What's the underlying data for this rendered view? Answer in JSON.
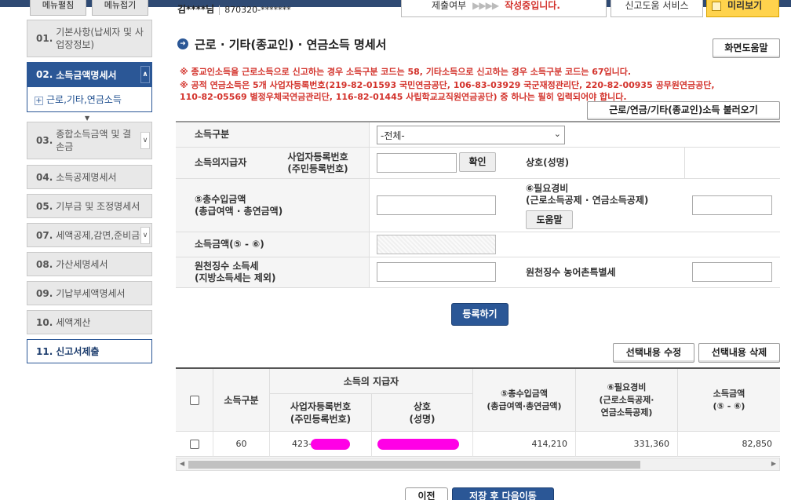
{
  "header": {
    "left_buttons": [
      "메뉴펼침",
      "메뉴접기"
    ],
    "taxpayer_name": "김****님",
    "taxpayer_rrn": "870320-*******",
    "status_label": "제출여부",
    "status_arrows": "▶▶▶▶",
    "status_value": "작성중입니다.",
    "help_service": "신고도움 서비스",
    "preview": "미리보기"
  },
  "sidebar": {
    "items": [
      {
        "num": "01.",
        "label": "기본사항(납세자 및 사업장정보)"
      },
      {
        "num": "02.",
        "label": "소득금액명세서"
      },
      {
        "num": "03.",
        "label": "종합소득금액 및 결손금"
      },
      {
        "num": "04.",
        "label": "소득공제명세서"
      },
      {
        "num": "05.",
        "label": "기부금 및 조정명세서"
      },
      {
        "num": "07.",
        "label": "세액공제,감면,준비금"
      },
      {
        "num": "08.",
        "label": "가산세명세서"
      },
      {
        "num": "09.",
        "label": "기납부세액명세서"
      },
      {
        "num": "10.",
        "label": "세액계산"
      },
      {
        "num": "11.",
        "label": "신고서제출"
      }
    ],
    "sub_item": "근로,기타,연금소득",
    "chev_up": "∧",
    "chev_down": "∨",
    "expand_arrow": "▼"
  },
  "main": {
    "section_icon": "➜",
    "title": "근로 · 기타(종교인) · 연금소득 명세서",
    "screen_help": "화면도움말",
    "notices": [
      "※ 종교인소득을 근로소득으로 신고하는 경우 소득구분 코드는 58, 기타소득으로 신고하는 경우 소득구분 코드는 67입니다.",
      "※ 공적 연금소득은 5개 사업자등록번호(219-82-01593 국민연금공단, 106-83-03929 국군재정관리단, 220-82-00935 공무원연금공단,",
      "110-82-05569 별정우체국연금관리단, 116-82-01445 사립학교교직원연금공단) 중 하나는 필히 입력되어야 합니다."
    ],
    "load_button": "근로/연금/기타(종교인)소득 불러오기"
  },
  "form": {
    "income_type_label": "소득구분",
    "income_type_value": "-전체-",
    "payer_label": "소득의지급자",
    "biz_no_label_1": "사업자등록번호",
    "biz_no_label_2": "(주민등록번호)",
    "confirm_button": "확인",
    "trade_name_label": "상호(성명)",
    "total_income_label_1": "⑤총수입금액",
    "total_income_label_2": "(총급여액 · 총연금액)",
    "expense_label_1": "⑥필요경비",
    "expense_label_2": "(근로소득공제 · 연금소득공제)",
    "help_button": "도움말",
    "income_amount_label": "소득금액(⑤ - ⑥)",
    "withholding_tax_label_1": "원천징수 소득세",
    "withholding_tax_label_2": "(지방소득세는 제외)",
    "rural_tax_label": "원천징수 농어촌특별세",
    "register_button": "등록하기"
  },
  "table_actions": {
    "edit": "선택내용 수정",
    "delete": "선택내용 삭제"
  },
  "table": {
    "headers": {
      "income_type": "소득구분",
      "payer_group": "소득의 지급자",
      "biz_no_1": "사업자등록번호",
      "biz_no_2": "(주민등록번호)",
      "trade_name_1": "상호",
      "trade_name_2": "(성명)",
      "total_1": "⑤총수입금액",
      "total_2": "(총급여액·총연금액)",
      "expense_1": "⑥필요경비",
      "expense_2": "(근로소득공제·",
      "expense_3": "연금소득공제)",
      "income_1": "소득금액",
      "income_2": "(⑤ - ⑥)"
    },
    "rows": [
      {
        "income_type": "60",
        "biz_no": "423-",
        "total": "414,210",
        "expense": "331,360",
        "income": "82,850"
      }
    ]
  },
  "bottom": {
    "prev": "이전",
    "save_next": "저장 후 다음이동"
  },
  "colors": {
    "accent": "#2b5796",
    "notice_red": "#d3332c",
    "redaction": "#ff00e6"
  }
}
